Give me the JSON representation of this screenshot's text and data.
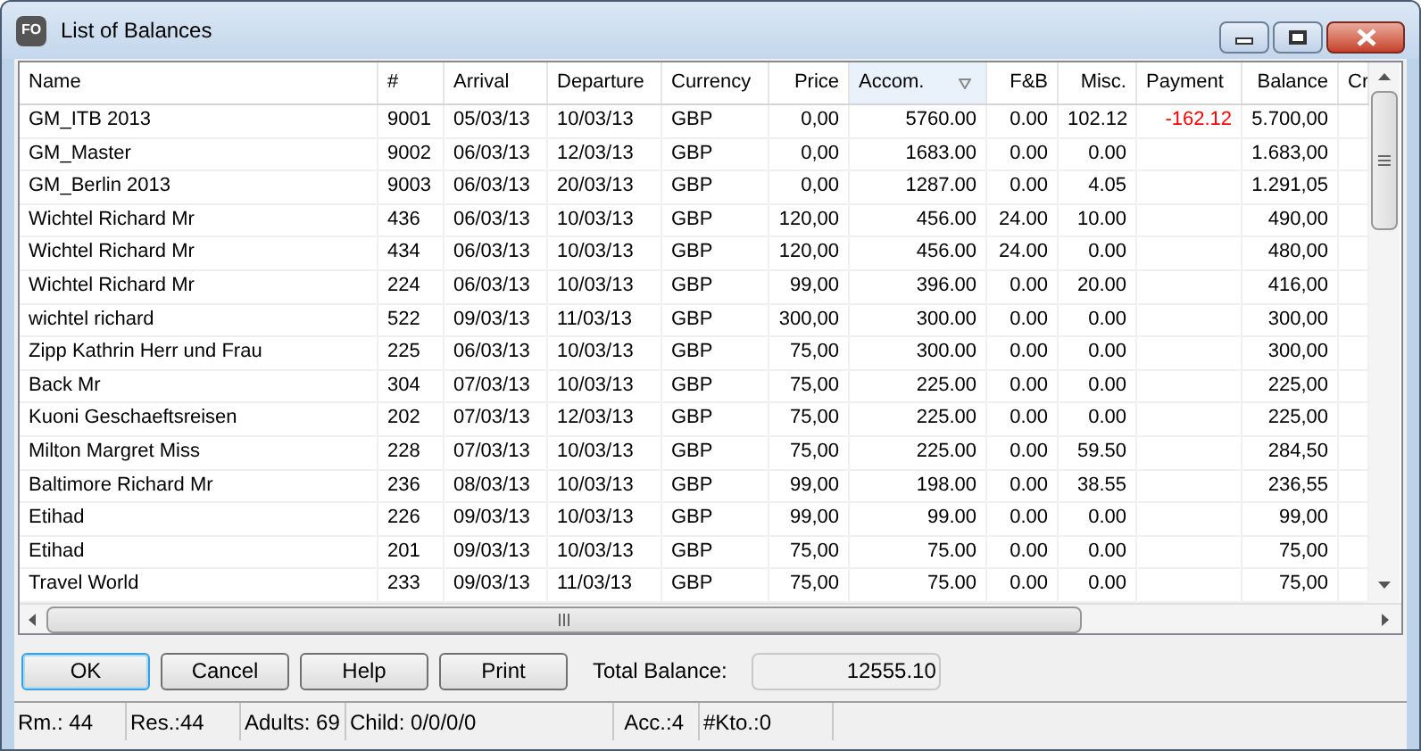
{
  "window": {
    "title": "List of Balances",
    "app_icon_text": "FO"
  },
  "table": {
    "columns": [
      {
        "label": "Name",
        "sorted": false
      },
      {
        "label": "#",
        "sorted": false
      },
      {
        "label": "Arrival",
        "sorted": false
      },
      {
        "label": "Departure",
        "sorted": false
      },
      {
        "label": "Currency",
        "sorted": false
      },
      {
        "label": "Price",
        "sorted": false
      },
      {
        "label": "Accom.",
        "sorted": true
      },
      {
        "label": "F&B",
        "sorted": false
      },
      {
        "label": "Misc.",
        "sorted": false
      },
      {
        "label": "Payment",
        "sorted": false
      },
      {
        "label": "Balance",
        "sorted": false
      },
      {
        "label": "Cr",
        "sorted": false
      }
    ],
    "rows": [
      {
        "cells": [
          "GM_ITB 2013",
          "9001",
          "05/03/13",
          "10/03/13",
          "GBP",
          "0,00",
          "5760.00",
          "0.00",
          "102.12",
          "-162.12",
          "5.700,00",
          ""
        ]
      },
      {
        "cells": [
          "GM_Master",
          "9002",
          "06/03/13",
          "12/03/13",
          "GBP",
          "0,00",
          "1683.00",
          "0.00",
          "0.00",
          "",
          "1.683,00",
          ""
        ]
      },
      {
        "cells": [
          "GM_Berlin 2013",
          "9003",
          "06/03/13",
          "20/03/13",
          "GBP",
          "0,00",
          "1287.00",
          "0.00",
          "4.05",
          "",
          "1.291,05",
          ""
        ]
      },
      {
        "cells": [
          "Wichtel Richard Mr",
          "436",
          "06/03/13",
          "10/03/13",
          "GBP",
          "120,00",
          "456.00",
          "24.00",
          "10.00",
          "",
          "490,00",
          ""
        ]
      },
      {
        "cells": [
          "Wichtel Richard Mr",
          "434",
          "06/03/13",
          "10/03/13",
          "GBP",
          "120,00",
          "456.00",
          "24.00",
          "0.00",
          "",
          "480,00",
          ""
        ]
      },
      {
        "cells": [
          "Wichtel Richard Mr",
          "224",
          "06/03/13",
          "10/03/13",
          "GBP",
          "99,00",
          "396.00",
          "0.00",
          "20.00",
          "",
          "416,00",
          ""
        ]
      },
      {
        "cells": [
          "wichtel richard",
          "522",
          "09/03/13",
          "11/03/13",
          "GBP",
          "300,00",
          "300.00",
          "0.00",
          "0.00",
          "",
          "300,00",
          ""
        ]
      },
      {
        "cells": [
          "Zipp Kathrin Herr und Frau",
          "225",
          "06/03/13",
          "10/03/13",
          "GBP",
          "75,00",
          "300.00",
          "0.00",
          "0.00",
          "",
          "300,00",
          ""
        ]
      },
      {
        "cells": [
          "Back  Mr",
          "304",
          "07/03/13",
          "10/03/13",
          "GBP",
          "75,00",
          "225.00",
          "0.00",
          "0.00",
          "",
          "225,00",
          ""
        ]
      },
      {
        "cells": [
          "Kuoni Geschaeftsreisen",
          "202",
          "07/03/13",
          "12/03/13",
          "GBP",
          "75,00",
          "225.00",
          "0.00",
          "0.00",
          "",
          "225,00",
          ""
        ]
      },
      {
        "cells": [
          "Milton Margret Miss",
          "228",
          "07/03/13",
          "10/03/13",
          "GBP",
          "75,00",
          "225.00",
          "0.00",
          "59.50",
          "",
          "284,50",
          ""
        ]
      },
      {
        "cells": [
          "Baltimore Richard Mr",
          "236",
          "08/03/13",
          "10/03/13",
          "GBP",
          "99,00",
          "198.00",
          "0.00",
          "38.55",
          "",
          "236,55",
          ""
        ]
      },
      {
        "cells": [
          "Etihad",
          "226",
          "09/03/13",
          "10/03/13",
          "GBP",
          "99,00",
          "99.00",
          "0.00",
          "0.00",
          "",
          "99,00",
          ""
        ]
      },
      {
        "cells": [
          "Etihad",
          "201",
          "09/03/13",
          "10/03/13",
          "GBP",
          "75,00",
          "75.00",
          "0.00",
          "0.00",
          "",
          "75,00",
          ""
        ]
      },
      {
        "cells": [
          "Travel World",
          "233",
          "09/03/13",
          "11/03/13",
          "GBP",
          "75,00",
          "75.00",
          "0.00",
          "0.00",
          "",
          "75,00",
          ""
        ]
      }
    ]
  },
  "buttons": [
    {
      "label": "OK",
      "selected": true
    },
    {
      "label": "Cancel",
      "selected": false
    },
    {
      "label": "Help",
      "selected": false
    },
    {
      "label": "Print",
      "selected": false
    }
  ],
  "total": {
    "label": "Total Balance:",
    "value": "12555.10"
  },
  "status_bar": [
    "Rm.: 44",
    "Res.:44",
    "Adults: 69",
    "Child: 0/0/0/0",
    "Acc.:4",
    "#Kto.:0"
  ]
}
